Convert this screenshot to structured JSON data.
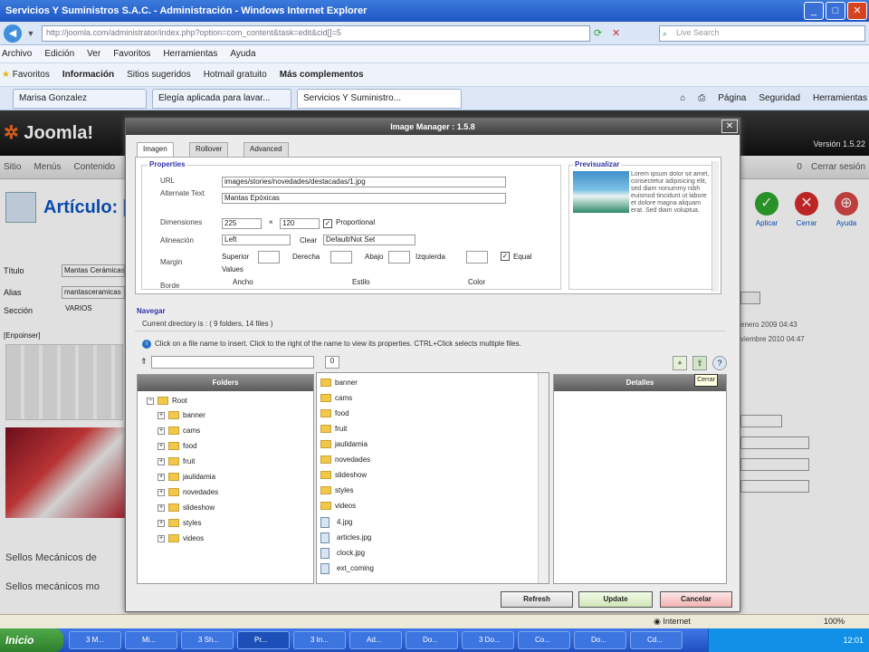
{
  "browser": {
    "title": "Servicios Y Suministros S.A.C. - Administración - Windows Internet Explorer",
    "url": "http://joomla.com/administrator/index.php?option=com_content&task=edit&cid[]=5",
    "search_placeholder": "Live Search",
    "menu": [
      "Archivo",
      "Edición",
      "Ver",
      "Favoritos",
      "Herramientas",
      "Ayuda"
    ],
    "favorites_bar": [
      "Favoritos",
      "Información",
      "Sitios sugeridos",
      "Hotmail gratuito",
      "Más complementos"
    ],
    "tabs": [
      "Marisa Gonzalez",
      "Elegía aplicada para lavar...",
      "Servicios Y Suministro..."
    ],
    "commands": [
      "Página",
      "Seguridad",
      "Herramientas"
    ],
    "status": "Internet",
    "zoom": "100%"
  },
  "joomla": {
    "logo": "Joomla!",
    "version": "Versión 1.5.22",
    "menu": [
      "Sitio",
      "Menús",
      "Contenido"
    ],
    "tools": [
      "0",
      "Cerrar sesión"
    ],
    "page_title": "Artículo: [",
    "toolbar": {
      "apply": "Aplicar",
      "close": "Cerrar",
      "help": "Ayuda"
    },
    "fields": [
      {
        "label": "Título",
        "value": "Mantas Cerámicas"
      },
      {
        "label": "Alias",
        "value": "mantasceramicas"
      },
      {
        "label": "Sección",
        "value": "VARIOS"
      }
    ],
    "editor_label": "[Enpoinser]",
    "body_lines": [
      "Sellos Mecánicos de",
      "Sellos mecánicos mo"
    ],
    "right_panel": [
      "enero 2009 04:43",
      "viembre 2010 04:47"
    ]
  },
  "modal": {
    "title": "Image Manager : 1.5.8",
    "tabs": [
      "Imagen",
      "Rollover",
      "Advanced"
    ],
    "props_legend": "Properties",
    "preview_legend": "Previsualizar",
    "labels": {
      "url": "URL",
      "alt": "Alternate Text",
      "dimensions": "Dimensiones",
      "proportional": "Proportional",
      "alignment": "Alineación",
      "clear": "Clear",
      "margin": "Margin",
      "top": "Superior",
      "right": "Derecha",
      "bottom": "Abajo",
      "left": "Izquierda",
      "equal": "Equal",
      "values": "Values",
      "border": "Borde",
      "width": "Ancho",
      "style": "Estilo",
      "color": "Color"
    },
    "values": {
      "url": "images/stories/novedades/destacadas/1.jpg",
      "alt": "Mantas Epóxicas",
      "width": "225",
      "x": "×",
      "height": "120",
      "alignment": "Left",
      "clear": "Default/Not Set"
    },
    "preview_text": "Lorem ipsum dolor sit amet, consectetur adipisicing elit, sed diam nonummy nibh euismod tincidunt ut labore et dolore magna aliquam erat. Sed diam voluptua.",
    "browse_legend": "Navegar",
    "current_dir": "Current directory is : ( 9 folders, 14 files )",
    "info_text": "Click on a file name to insert. Click to the right of the name to view its properties. CTRL+Click selects multiple files.",
    "filter_value": "0",
    "folders_head": "Folders",
    "root": "Root",
    "folders": [
      "banner",
      "cams",
      "food",
      "fruit",
      "jaulidamia",
      "novedades",
      "slideshow",
      "styles",
      "videos"
    ],
    "files": [
      {
        "name": "banner",
        "type": "folder"
      },
      {
        "name": "cams",
        "type": "folder"
      },
      {
        "name": "food",
        "type": "folder"
      },
      {
        "name": "fruit",
        "type": "folder"
      },
      {
        "name": "jaulidamia",
        "type": "folder"
      },
      {
        "name": "novedades",
        "type": "folder"
      },
      {
        "name": "slideshow",
        "type": "folder"
      },
      {
        "name": "styles",
        "type": "folder"
      },
      {
        "name": "videos",
        "type": "folder"
      },
      {
        "name": "4.jpg",
        "type": "file"
      },
      {
        "name": "articles.jpg",
        "type": "file"
      },
      {
        "name": "clock.jpg",
        "type": "file"
      },
      {
        "name": "ext_coming",
        "type": "file"
      }
    ],
    "details_head": "Detalles",
    "tooltip": "Cerrar",
    "buttons": {
      "refresh": "Refresh",
      "update": "Update",
      "cancel": "Cancelar"
    }
  },
  "taskbar": {
    "start": "Inicio",
    "buttons": [
      "3 M...",
      "Mi...",
      "3 Sh...",
      "Pr...",
      "3 In...",
      "Ad...",
      "Do...",
      "3 Do...",
      "Co...",
      "Do...",
      "Cd..."
    ],
    "clock": "12:01"
  }
}
